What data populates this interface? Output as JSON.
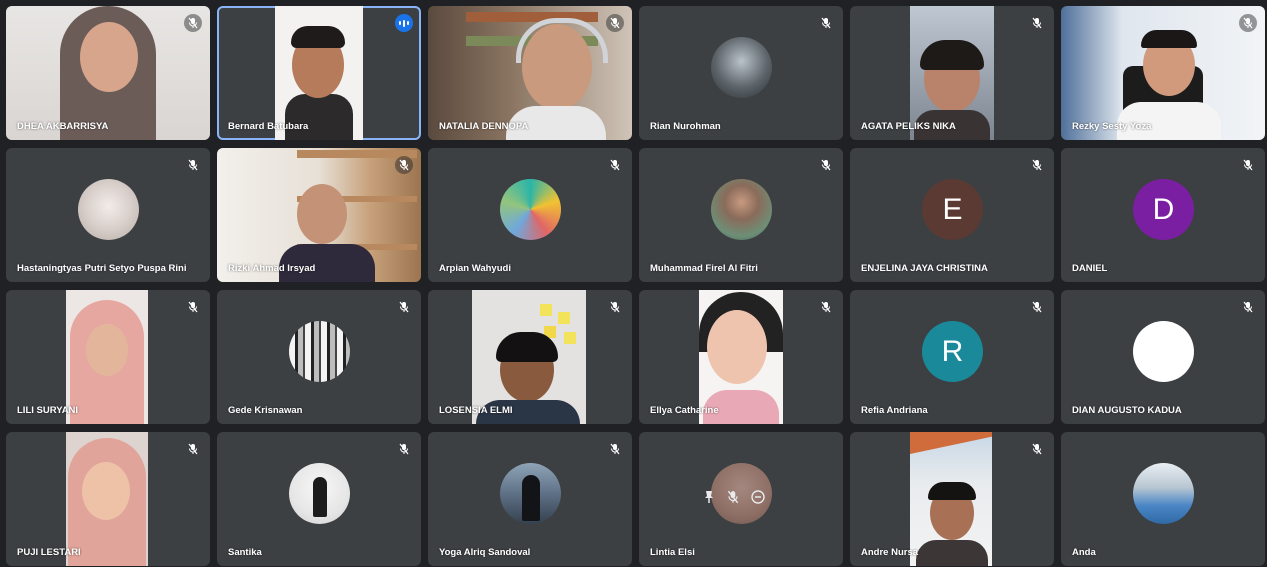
{
  "participants": [
    {
      "name": "DHEA AKBARRISYA"
    },
    {
      "name": "Bernard Batubara"
    },
    {
      "name": "NATALIA DENNOPA"
    },
    {
      "name": "Rian Nurohman"
    },
    {
      "name": "AGATA PELIKS NIKA"
    },
    {
      "name": "Rezky Sesty Yoza"
    },
    {
      "name": "Hastaningtyas Putri Setyo Puspa Rini"
    },
    {
      "name": "Rizki Ahmad Irsyad"
    },
    {
      "name": "Arpian Wahyudi"
    },
    {
      "name": "Muhammad Firel Al Fitri"
    },
    {
      "name": "ENJELINA JAYA CHRISTINA",
      "initial": "E",
      "color": "#5b3a33"
    },
    {
      "name": "DANIEL",
      "initial": "D",
      "color": "#7b1fa2"
    },
    {
      "name": "LILI SURYANI"
    },
    {
      "name": "Gede Krisnawan"
    },
    {
      "name": "LOSENSIA ELMI"
    },
    {
      "name": "Ellya Catharine"
    },
    {
      "name": "Refia Andriana",
      "initial": "R",
      "color": "#1a8a9a"
    },
    {
      "name": "DIAN AUGUSTO KADUA"
    },
    {
      "name": "PUJI LESTARI"
    },
    {
      "name": "Santika"
    },
    {
      "name": "Yoga Alriq Sandoval"
    },
    {
      "name": "Lintia Elsi"
    },
    {
      "name": "Andre Nursa"
    },
    {
      "name": "Anda"
    }
  ],
  "icons": {
    "muted": "mic-off-icon",
    "speaking": "speaking-indicator-icon",
    "pin": "pin-icon",
    "remove": "remove-icon"
  },
  "colors": {
    "background": "#202124",
    "tile": "#3c4043",
    "active_outline": "#8ab4f8",
    "speaking": "#1a73e8"
  }
}
